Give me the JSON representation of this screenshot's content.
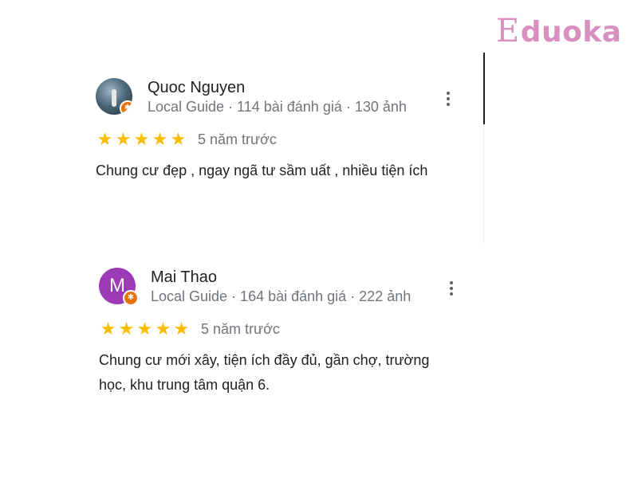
{
  "brand": {
    "logo_letter": "E",
    "logo_text": "duoka",
    "color": "#d98fbf"
  },
  "reviews": [
    {
      "name": "Quoc Nguyen",
      "meta": "Local Guide · 114 bài đánh giá · 130 ảnh",
      "avatar_type": "photo",
      "badge_icon": "local-guide-icon",
      "rating": 5,
      "stars": [
        "★",
        "★",
        "★",
        "★",
        "★"
      ],
      "time": "5 năm trước",
      "text": "Chung cư đẹp , ngay ngã tư sầm uất , nhiều tiện ích"
    },
    {
      "name": "Mai Thao",
      "meta": "Local Guide · 164 bài đánh giá · 222 ảnh",
      "avatar_type": "letter",
      "avatar_letter": "M",
      "avatar_color": "#9c3bb5",
      "badge_icon": "local-guide-icon",
      "rating": 5,
      "stars": [
        "★",
        "★",
        "★",
        "★",
        "★"
      ],
      "time": "5 năm trước",
      "text": "Chung cư mới xây, tiện ích đầy đủ, gần chợ, trường học, khu trung tâm quận 6."
    }
  ],
  "colors": {
    "star": "#fbbc04",
    "secondary_text": "#70757a",
    "badge": "#e8710a"
  }
}
